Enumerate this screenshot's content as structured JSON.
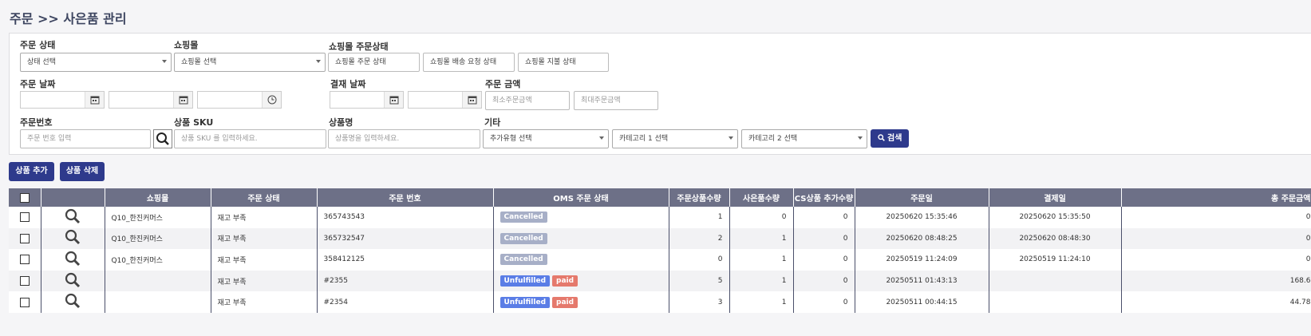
{
  "page": {
    "title": "주문 >> 사은품 관리"
  },
  "filters": {
    "order_status": {
      "label": "주문 상태",
      "value": "상태 선택"
    },
    "mall": {
      "label": "쇼핑몰",
      "value": "쇼핑몰 선택"
    },
    "mall_order_status": {
      "label": "쇼핑몰 주문상태",
      "fields": [
        "쇼핑몰 주문 상태",
        "쇼핑몰 배송 요청 상태",
        "쇼핑몰 지불 상태"
      ]
    },
    "order_date": {
      "label": "주문 날짜"
    },
    "pay_date": {
      "label": "결재 날짜"
    },
    "order_amount": {
      "label": "주문 금액",
      "min_placeholder": "최소주문금액",
      "max_placeholder": "최대주문금액"
    },
    "order_no": {
      "label": "주문번호",
      "placeholder": "주문 번호 입력"
    },
    "sku": {
      "label": "상품 SKU",
      "placeholder": "상품 SKU 를 입력하세요."
    },
    "product_name": {
      "label": "상품명",
      "placeholder": "상품명을 입력하세요."
    },
    "etc": {
      "label": "기타",
      "type_value": "추가유형 선택",
      "cat1_value": "카테고리 1 선택",
      "cat2_value": "카테고리 2 선택"
    },
    "search_label": "검색"
  },
  "actions": {
    "add_label": "상품 추가",
    "delete_label": "상품 삭제"
  },
  "table": {
    "headers": [
      "쇼핑몰",
      "주문 상태",
      "주문 번호",
      "OMS 주문 상태",
      "주문상품수량",
      "사은품수량",
      "CS상품 추가수량",
      "주문일",
      "결제일",
      "총 주문금액"
    ],
    "rows": [
      {
        "mall": "Q10_한진커머스",
        "status": "재고 부족",
        "order_no": "365743543",
        "oms": "Cancelled",
        "pay": "",
        "qty": "1",
        "gift": "0",
        "cs": "0",
        "order_date": "20250620 15:35:46",
        "pay_date": "20250620 15:35:50",
        "total": "0"
      },
      {
        "mall": "Q10_한진커머스",
        "status": "재고 부족",
        "order_no": "365732547",
        "oms": "Cancelled",
        "pay": "",
        "qty": "2",
        "gift": "1",
        "cs": "0",
        "order_date": "20250620 08:48:25",
        "pay_date": "20250620 08:48:30",
        "total": "0"
      },
      {
        "mall": "Q10_한진커머스",
        "status": "재고 부족",
        "order_no": "358412125",
        "oms": "Cancelled",
        "pay": "",
        "qty": "0",
        "gift": "1",
        "cs": "0",
        "order_date": "20250519 11:24:09",
        "pay_date": "20250519 11:24:10",
        "total": "0"
      },
      {
        "mall": "",
        "status": "재고 부족",
        "order_no": "#2355",
        "oms": "Unfulfilled",
        "pay": "paid",
        "qty": "5",
        "gift": "1",
        "cs": "0",
        "order_date": "20250511 01:43:13",
        "pay_date": "",
        "total": "168.6"
      },
      {
        "mall": "",
        "status": "재고 부족",
        "order_no": "#2354",
        "oms": "Unfulfilled",
        "pay": "paid",
        "qty": "3",
        "gift": "1",
        "cs": "0",
        "order_date": "20250511 00:44:15",
        "pay_date": "",
        "total": "44.78"
      }
    ]
  },
  "colors": {
    "primary": "#2e3a8c",
    "header_bg": "#6d7087",
    "cancelled": "#a7afc7",
    "unfulfilled": "#5a7de6",
    "paid": "#e5796c"
  }
}
